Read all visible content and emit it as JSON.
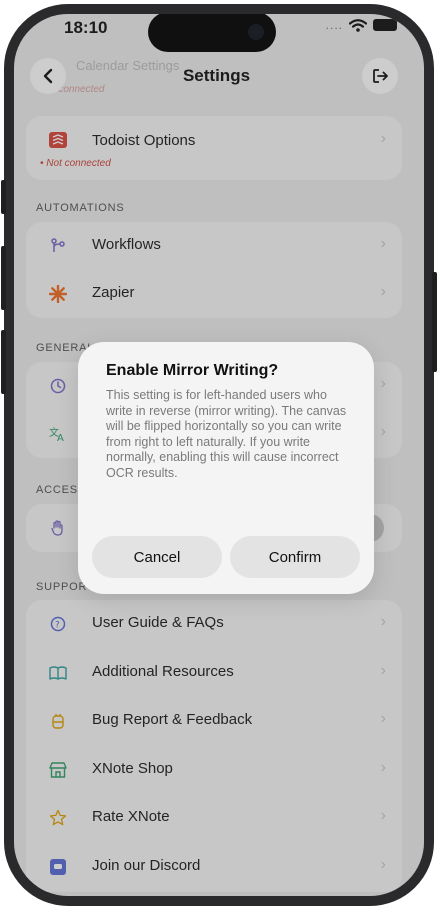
{
  "status_bar": {
    "time": "18:10",
    "signal_dots": "...."
  },
  "nav": {
    "title": "Settings",
    "ghost_title": "Calendar Settings",
    "ghost_subtitle": "Not connected"
  },
  "todoist": {
    "label": "Todoist Options",
    "status": "• Not connected"
  },
  "sections": {
    "automations": "AUTOMATIONS",
    "general": "GENERAL",
    "accessibility": "ACCESSIBILITY",
    "support": "SUPPORT"
  },
  "automations": [
    {
      "label": "Workflows",
      "icon": "workflow-icon"
    },
    {
      "label": "Zapier",
      "icon": "zapier-icon"
    }
  ],
  "support": [
    {
      "label": "User Guide & FAQs",
      "icon": "help-icon"
    },
    {
      "label": "Additional Resources",
      "icon": "book-icon"
    },
    {
      "label": "Bug Report & Feedback",
      "icon": "bug-icon"
    },
    {
      "label": "XNote Shop",
      "icon": "shop-icon"
    },
    {
      "label": "Rate XNote",
      "icon": "star-icon"
    },
    {
      "label": "Join our Discord",
      "icon": "discord-icon"
    }
  ],
  "chevron": "›",
  "dialog": {
    "title": "Enable Mirror Writing?",
    "message": "This setting is for left-handed users who write in reverse (mirror writing). The canvas will be flipped horizontally so you can write from right to left naturally. If you write normally, enabling this will cause incorrect OCR results.",
    "cancel": "Cancel",
    "confirm": "Confirm"
  },
  "colors": {
    "todoist_red": "#d9453a",
    "workflow_purple": "#7b68c8",
    "zapier_orange": "#f26b21",
    "shop_green": "#2e9e6b",
    "star_yellow": "#e0a100",
    "discord_indigo": "#5a6bd6"
  }
}
